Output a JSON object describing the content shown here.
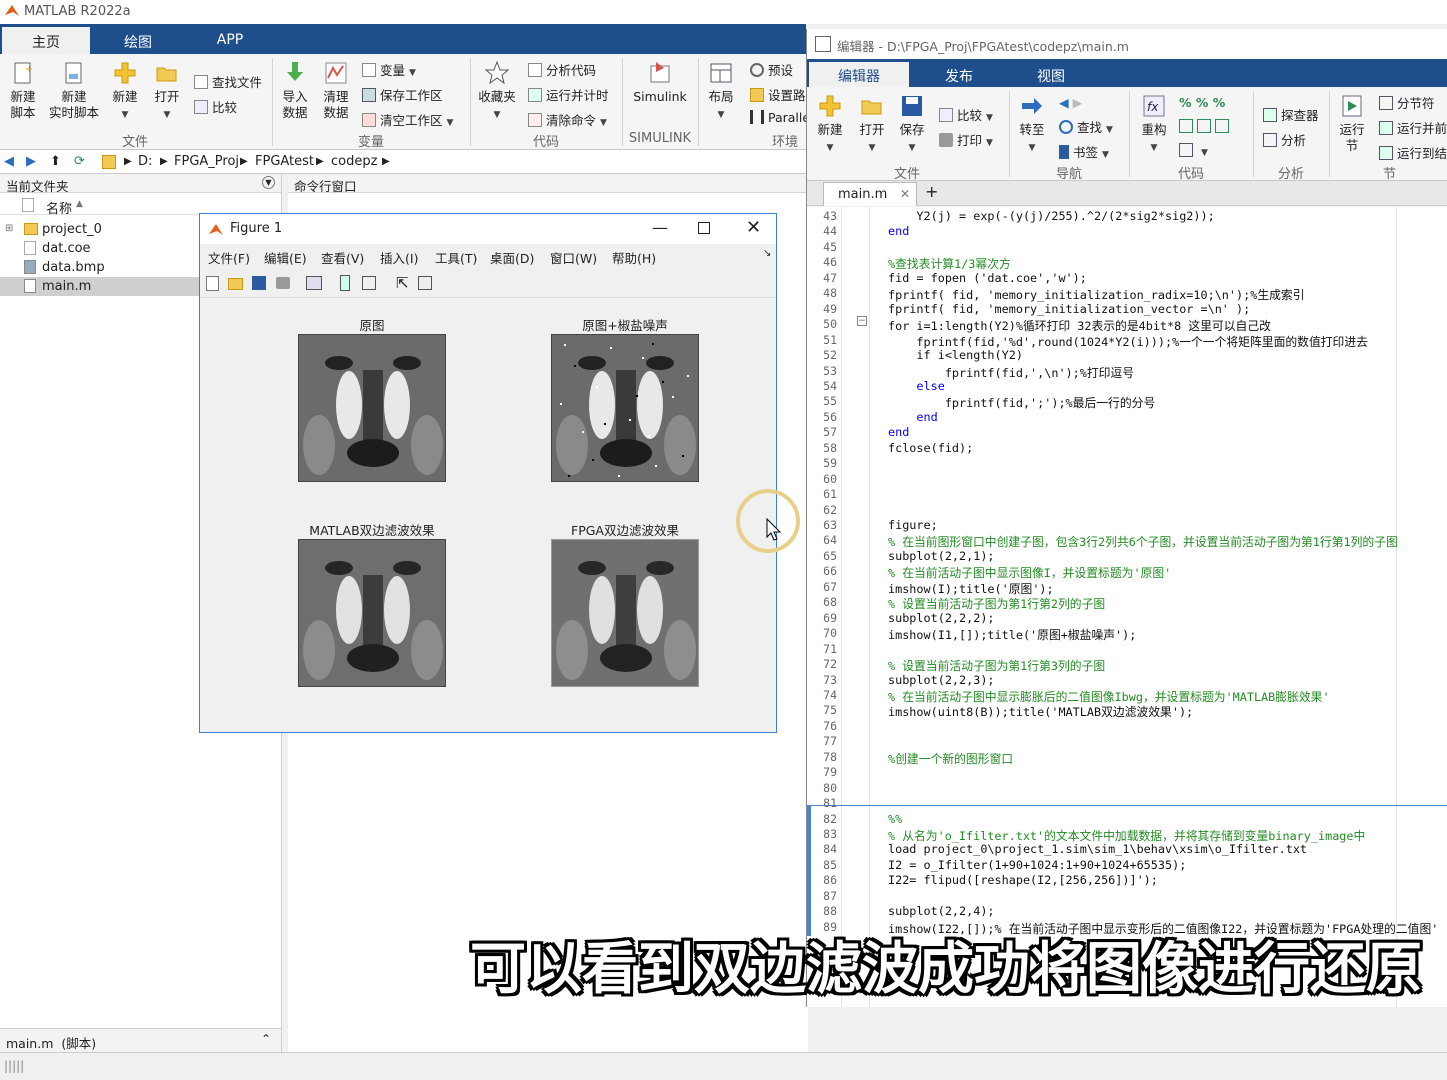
{
  "app": {
    "title": "MATLAB R2022a"
  },
  "main_tabs": [
    "主页",
    "绘图",
    "APP"
  ],
  "home_ribbon": {
    "new_script": "新建\n脚本",
    "new_live_script": "新建\n实时脚本",
    "new": "新建",
    "open": "打开",
    "find_files": "查找文件",
    "compare": "比较",
    "import_data": "导入\n数据",
    "clean_data": "清理\n数据",
    "variable": "变量",
    "save_workspace": "保存工作区",
    "clear_workspace": "清空工作区",
    "favorites": "收藏夹",
    "analyze_code": "分析代码",
    "run_and_time": "运行并计时",
    "clear_commands": "清除命令",
    "simulink": "Simulink",
    "layout": "布局",
    "preferences": "预设",
    "set_path": "设置路",
    "parallel": "Paralle",
    "groups": [
      "文件",
      "变量",
      "代码",
      "SIMULINK",
      "环境"
    ]
  },
  "pathbar": {
    "segments": [
      "D:",
      "FPGA_Proj",
      "FPGAtest",
      "codepz"
    ]
  },
  "file_panel": {
    "title": "当前文件夹",
    "column": "名称",
    "files": [
      "project_0",
      "dat.coe",
      "data.bmp",
      "main.m"
    ],
    "footer": "main.m  (脚本)"
  },
  "command_window": {
    "title": "命令行窗口"
  },
  "figure": {
    "title": "Figure 1",
    "menu": [
      "文件(F)",
      "编辑(E)",
      "查看(V)",
      "插入(I)",
      "工具(T)",
      "桌面(D)",
      "窗口(W)",
      "帮助(H)"
    ],
    "subplots": [
      "原图",
      "原图+椒盐噪声",
      "MATLAB双边滤波效果",
      "FPGA双边滤波效果"
    ]
  },
  "editor": {
    "title": "编辑器 - D:\\FPGA_Proj\\FPGAtest\\codepz\\main.m",
    "tabs": [
      "编辑器",
      "发布",
      "视图"
    ],
    "ribbon": {
      "new": "新建",
      "open": "打开",
      "save": "保存",
      "compare": "比较",
      "print": "打印",
      "goto": "转至",
      "find": "查找",
      "bookmark": "书签",
      "refactor": "重构",
      "profiler": "探查器",
      "analyze": "分析",
      "run_section": "运行\n节",
      "section_break": "分节符",
      "run_and_advance": "运行并前",
      "run_to_end": "运行到结",
      "groups": [
        "文件",
        "导航",
        "代码",
        "分析",
        "节"
      ]
    },
    "file_tab": "main.m",
    "lines": [
      {
        "n": "43",
        "t": "    Y2(j) = exp(-(y(j)/255).^2/(2*sig2*sig2));",
        "c": ""
      },
      {
        "n": "44",
        "t": "end",
        "c": "kw"
      },
      {
        "n": "45",
        "t": "",
        "c": ""
      },
      {
        "n": "46",
        "t": "%查找表计算1/3幂次方",
        "c": "cm"
      },
      {
        "n": "47",
        "t": "fid = fopen ('dat.coe','w');",
        "c": ""
      },
      {
        "n": "48",
        "t": "fprintf( fid, 'memory_initialization_radix=10;\\n');%生成索引",
        "c": ""
      },
      {
        "n": "49",
        "t": "fprintf( fid, 'memory_initialization_vector =\\n' );",
        "c": ""
      },
      {
        "n": "50",
        "t": "for i=1:length(Y2)%循环打印 32表示的是4bit*8 这里可以自己改",
        "c": ""
      },
      {
        "n": "51",
        "t": "    fprintf(fid,'%d',round(1024*Y2(i)));%一个一个将矩阵里面的数值打印进去",
        "c": ""
      },
      {
        "n": "52",
        "t": "    if i<length(Y2)",
        "c": ""
      },
      {
        "n": "53",
        "t": "        fprintf(fid,',\\n');%打印逗号",
        "c": ""
      },
      {
        "n": "54",
        "t": "    else",
        "c": "kw"
      },
      {
        "n": "55",
        "t": "        fprintf(fid,';');%最后一行的分号",
        "c": ""
      },
      {
        "n": "56",
        "t": "    end",
        "c": "kw"
      },
      {
        "n": "57",
        "t": "end",
        "c": "kw"
      },
      {
        "n": "58",
        "t": "fclose(fid);",
        "c": ""
      },
      {
        "n": "59",
        "t": "",
        "c": ""
      },
      {
        "n": "60",
        "t": "",
        "c": ""
      },
      {
        "n": "61",
        "t": "",
        "c": ""
      },
      {
        "n": "62",
        "t": "",
        "c": ""
      },
      {
        "n": "63",
        "t": "figure;",
        "c": ""
      },
      {
        "n": "64",
        "t": "% 在当前图形窗口中创建子图，包含3行2列共6个子图，并设置当前活动子图为第1行第1列的子图",
        "c": "cm"
      },
      {
        "n": "65",
        "t": "subplot(2,2,1);",
        "c": ""
      },
      {
        "n": "66",
        "t": "% 在当前活动子图中显示图像I，并设置标题为'原图'",
        "c": "cm"
      },
      {
        "n": "67",
        "t": "imshow(I);title('原图');",
        "c": ""
      },
      {
        "n": "68",
        "t": "% 设置当前活动子图为第1行第2列的子图",
        "c": "cm"
      },
      {
        "n": "69",
        "t": "subplot(2,2,2);",
        "c": ""
      },
      {
        "n": "70",
        "t": "imshow(I1,[]);title('原图+椒盐噪声');",
        "c": ""
      },
      {
        "n": "71",
        "t": "",
        "c": ""
      },
      {
        "n": "72",
        "t": "% 设置当前活动子图为第1行第3列的子图",
        "c": "cm"
      },
      {
        "n": "73",
        "t": "subplot(2,2,3);",
        "c": ""
      },
      {
        "n": "74",
        "t": "% 在当前活动子图中显示膨胀后的二值图像Ibwg，并设置标题为'MATLAB膨胀效果'",
        "c": "cm"
      },
      {
        "n": "75",
        "t": "imshow(uint8(B));title('MATLAB双边滤波效果');",
        "c": ""
      },
      {
        "n": "76",
        "t": "",
        "c": ""
      },
      {
        "n": "77",
        "t": "",
        "c": ""
      },
      {
        "n": "78",
        "t": "%创建一个新的图形窗口",
        "c": "cm"
      },
      {
        "n": "79",
        "t": "",
        "c": ""
      },
      {
        "n": "80",
        "t": "",
        "c": ""
      },
      {
        "n": "81",
        "t": "",
        "c": ""
      },
      {
        "n": "82",
        "t": "%%",
        "c": "cm"
      },
      {
        "n": "83",
        "t": "% 从名为'o_Ifilter.txt'的文本文件中加载数据，并将其存储到变量binary_image中",
        "c": "cm"
      },
      {
        "n": "84",
        "t": "load project_0\\project_1.sim\\sim_1\\behav\\xsim\\o_Ifilter.txt",
        "c": ""
      },
      {
        "n": "85",
        "t": "I2 = o_Ifilter(1+90+1024:1+90+1024+65535);",
        "c": ""
      },
      {
        "n": "86",
        "t": "I22= flipud([reshape(I2,[256,256])]');",
        "c": ""
      },
      {
        "n": "87",
        "t": "",
        "c": ""
      },
      {
        "n": "88",
        "t": "subplot(2,2,4);",
        "c": ""
      },
      {
        "n": "89",
        "t": "imshow(I22,[]);% 在当前活动子图中显示变形后的二值图像I22，并设置标题为'FPGA处理的二值图'",
        "c": ""
      }
    ]
  },
  "subtitle": "可以看到双边滤波成功将图像进行还原"
}
